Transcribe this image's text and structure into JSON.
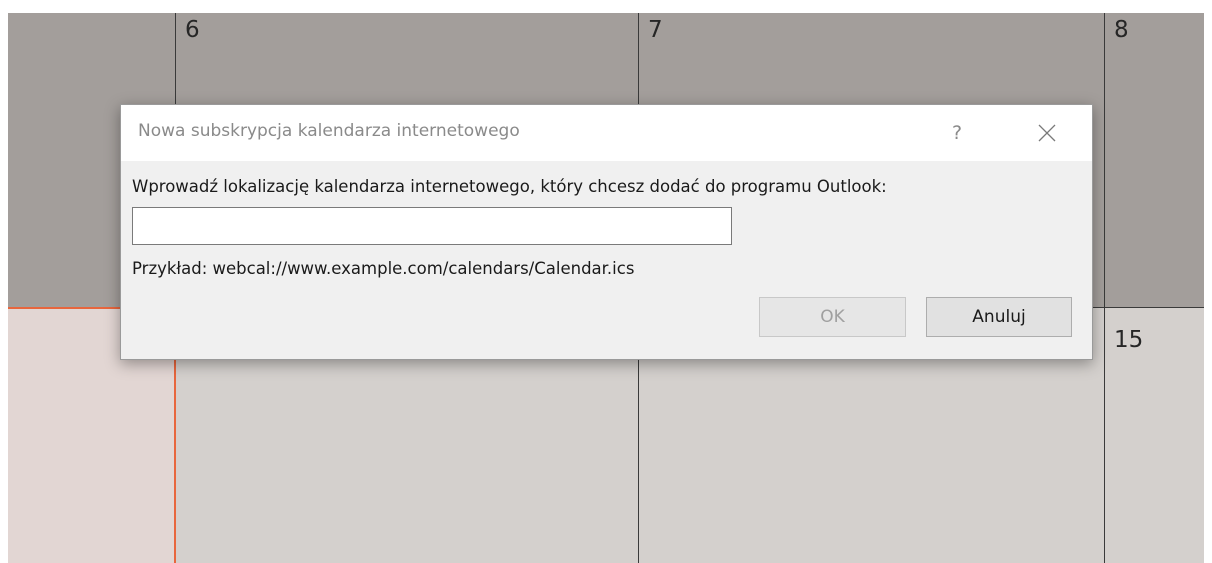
{
  "calendar": {
    "day_numbers": [
      "6",
      "7",
      "8",
      "15"
    ],
    "colors": {
      "past_week_bg": "#a39e9b",
      "current_week_bg": "#d4d0cd",
      "today_bg": "#e2d6d3",
      "today_accent": "#e8663d"
    }
  },
  "dialog": {
    "title": "Nowa subskrypcja kalendarza internetowego",
    "help_label": "?",
    "close_icon": "close-icon",
    "prompt": "Wprowadź lokalizację kalendarza internetowego, który chcesz dodać do programu Outlook:",
    "url_input": {
      "value": "",
      "placeholder": ""
    },
    "example": "Przykład: webcal://www.example.com/calendars/Calendar.ics",
    "ok_label": "OK",
    "cancel_label": "Anuluj"
  }
}
